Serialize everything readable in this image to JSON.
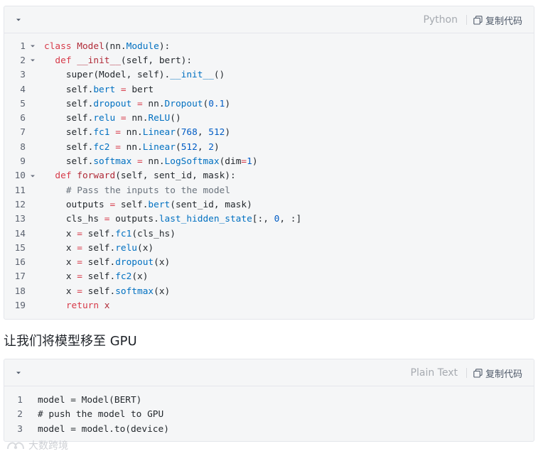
{
  "python_block": {
    "language": "Python",
    "copy_label": "复制代码",
    "lines": [
      {
        "n": "1",
        "fold": true
      },
      {
        "n": "2",
        "fold": true
      },
      {
        "n": "3"
      },
      {
        "n": "4"
      },
      {
        "n": "5"
      },
      {
        "n": "6"
      },
      {
        "n": "7"
      },
      {
        "n": "8"
      },
      {
        "n": "9"
      },
      {
        "n": "10",
        "fold": true
      },
      {
        "n": "11"
      },
      {
        "n": "12"
      },
      {
        "n": "13"
      },
      {
        "n": "14"
      },
      {
        "n": "15"
      },
      {
        "n": "16"
      },
      {
        "n": "17"
      },
      {
        "n": "18"
      },
      {
        "n": "19"
      }
    ],
    "code_text": [
      "class Model(nn.Module):",
      "  def __init__(self, bert):",
      "    super(Model, self).__init__()",
      "    self.bert = bert",
      "    self.dropout = nn.Dropout(0.1)",
      "    self.relu = nn.ReLU()",
      "    self.fc1 = nn.Linear(768, 512)",
      "    self.fc2 = nn.Linear(512, 2)",
      "    self.softmax = nn.LogSoftmax(dim=1)",
      "  def forward(self, sent_id, mask):",
      "    # Pass the inputs to the model",
      "    outputs = self.bert(sent_id, mask)",
      "    cls_hs = outputs.last_hidden_state[:, 0, :]",
      "    x = self.fc1(cls_hs)",
      "    x = self.relu(x)",
      "    x = self.dropout(x)",
      "    x = self.fc2(x)",
      "    x = self.softmax(x)",
      "    return x"
    ]
  },
  "heading": "让我们将模型移至 GPU",
  "plain_block": {
    "language": "Plain Text",
    "copy_label": "复制代码",
    "lines": [
      {
        "n": "1",
        "text": "model = Model(BERT)"
      },
      {
        "n": "2",
        "text": "# push the model to GPU"
      },
      {
        "n": "3",
        "text": "model = model.to(device)"
      }
    ]
  },
  "watermark": "大数跨境",
  "colors": {
    "keyword": "#d73a49",
    "function": "#b02a37",
    "attribute": "#0070c1",
    "number": "#005cc5",
    "comment": "#6a737d",
    "block_bg": "#f5f6f7"
  }
}
